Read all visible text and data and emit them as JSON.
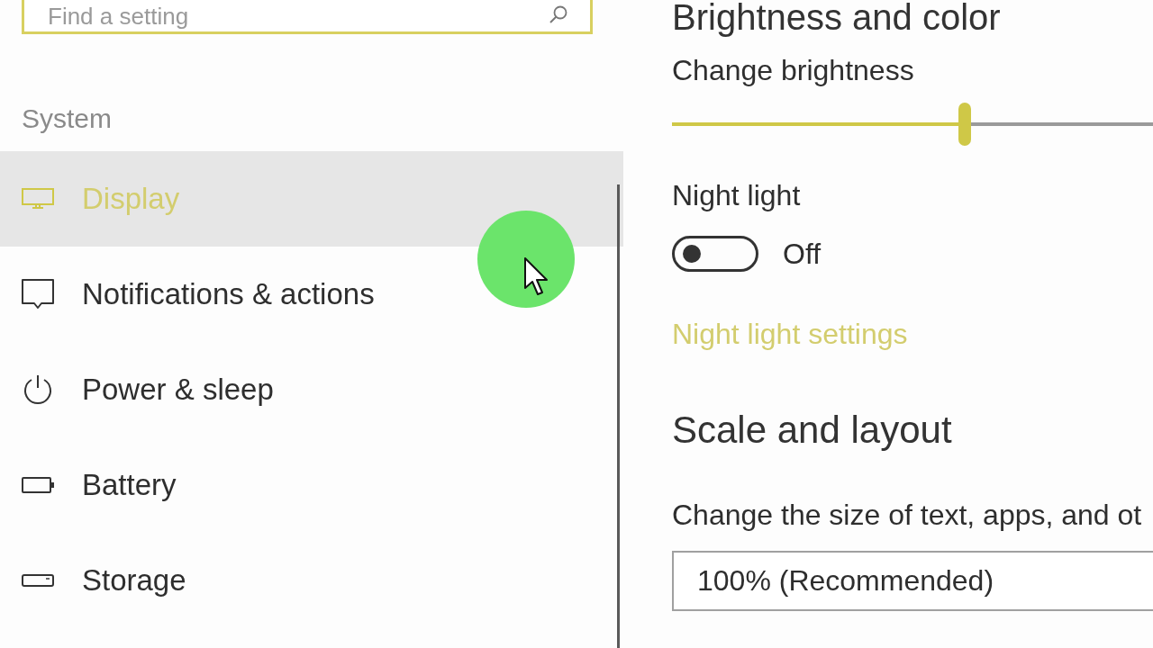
{
  "search": {
    "placeholder": "Find a setting"
  },
  "sidebar": {
    "section": "System",
    "items": [
      {
        "label": "Display",
        "selected": true
      },
      {
        "label": "Notifications & actions",
        "selected": false
      },
      {
        "label": "Power & sleep",
        "selected": false
      },
      {
        "label": "Battery",
        "selected": false
      },
      {
        "label": "Storage",
        "selected": false
      }
    ]
  },
  "content": {
    "heading": "Brightness and color",
    "brightness": {
      "label": "Change brightness",
      "level": 0.58
    },
    "night_light": {
      "label": "Night light",
      "on": false,
      "state_text": "Off",
      "link": "Night light settings"
    },
    "scale": {
      "heading": "Scale and layout",
      "label": "Change the size of text, apps, and ot",
      "dropdown": {
        "value": "100% (Recommended)"
      }
    }
  }
}
